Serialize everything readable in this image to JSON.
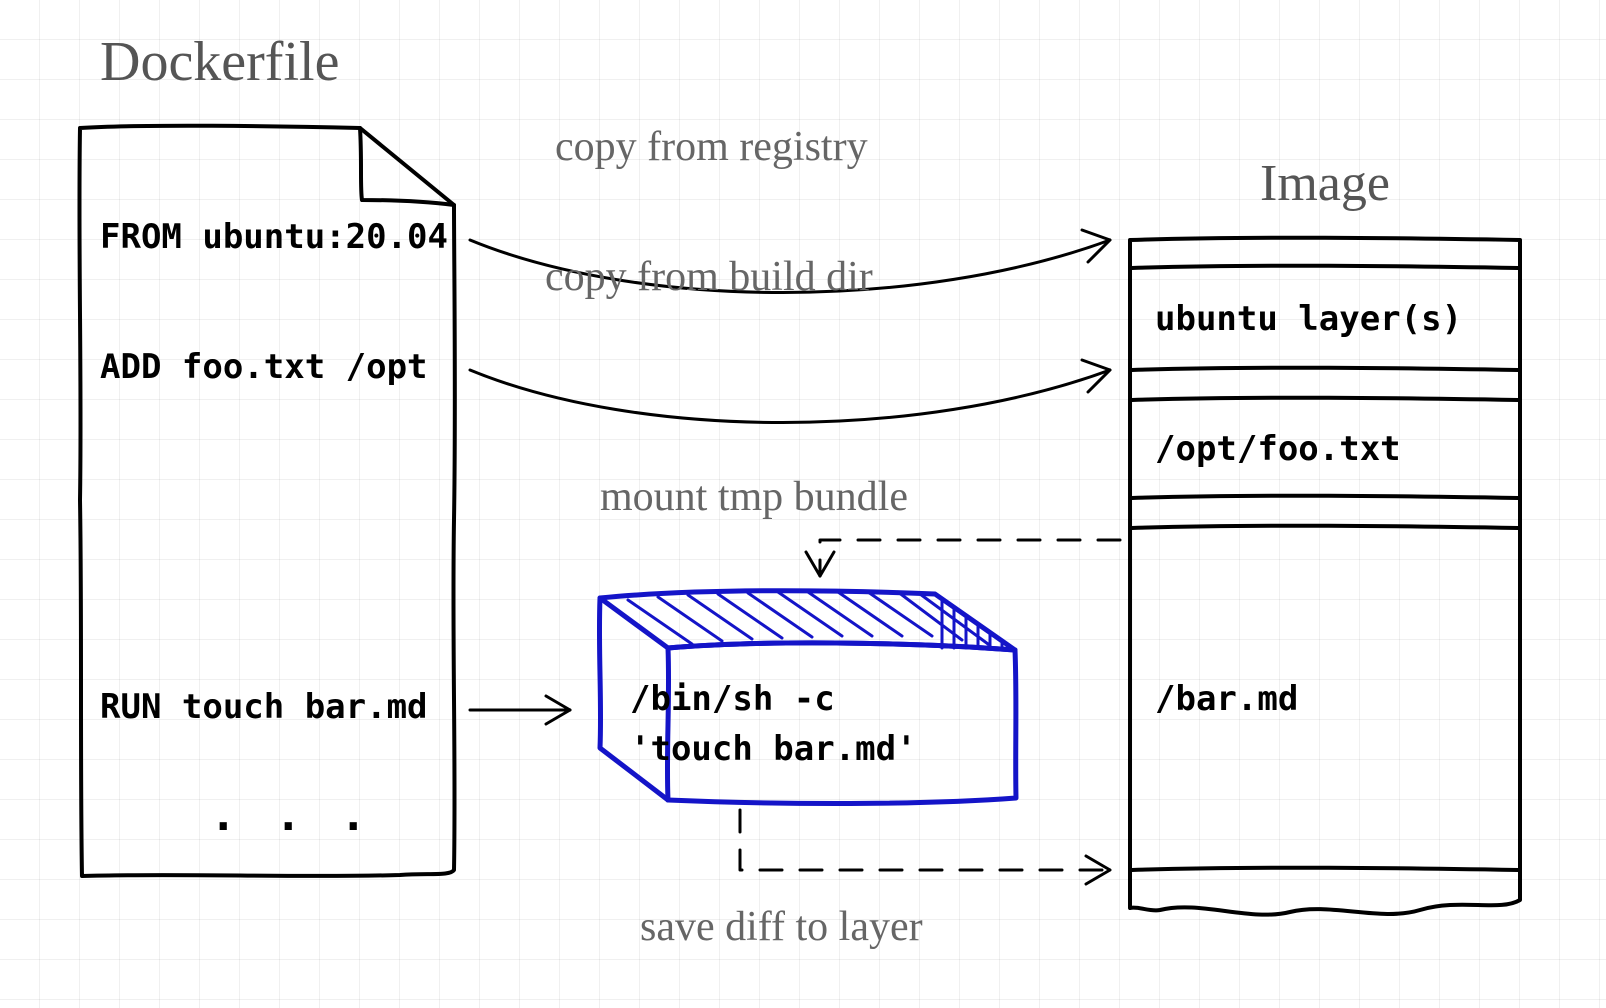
{
  "titles": {
    "dockerfile": "Dockerfile",
    "image": "Image"
  },
  "dockerfile": {
    "line_from": "FROM ubuntu:20.04",
    "line_add": "ADD foo.txt /opt",
    "line_run": "RUN touch bar.md",
    "ellipsis": ". . ."
  },
  "labels": {
    "copy_registry": "copy from registry",
    "copy_build_dir": "copy from build dir",
    "mount_tmp": "mount tmp bundle",
    "save_diff": "save diff to layer"
  },
  "container": {
    "cmd_line1": "/bin/sh -c",
    "cmd_line2": "'touch bar.md'"
  },
  "image": {
    "layer_ubuntu": "ubuntu layer(s)",
    "layer_foo": "/opt/foo.txt",
    "layer_bar": "/bar.md"
  }
}
